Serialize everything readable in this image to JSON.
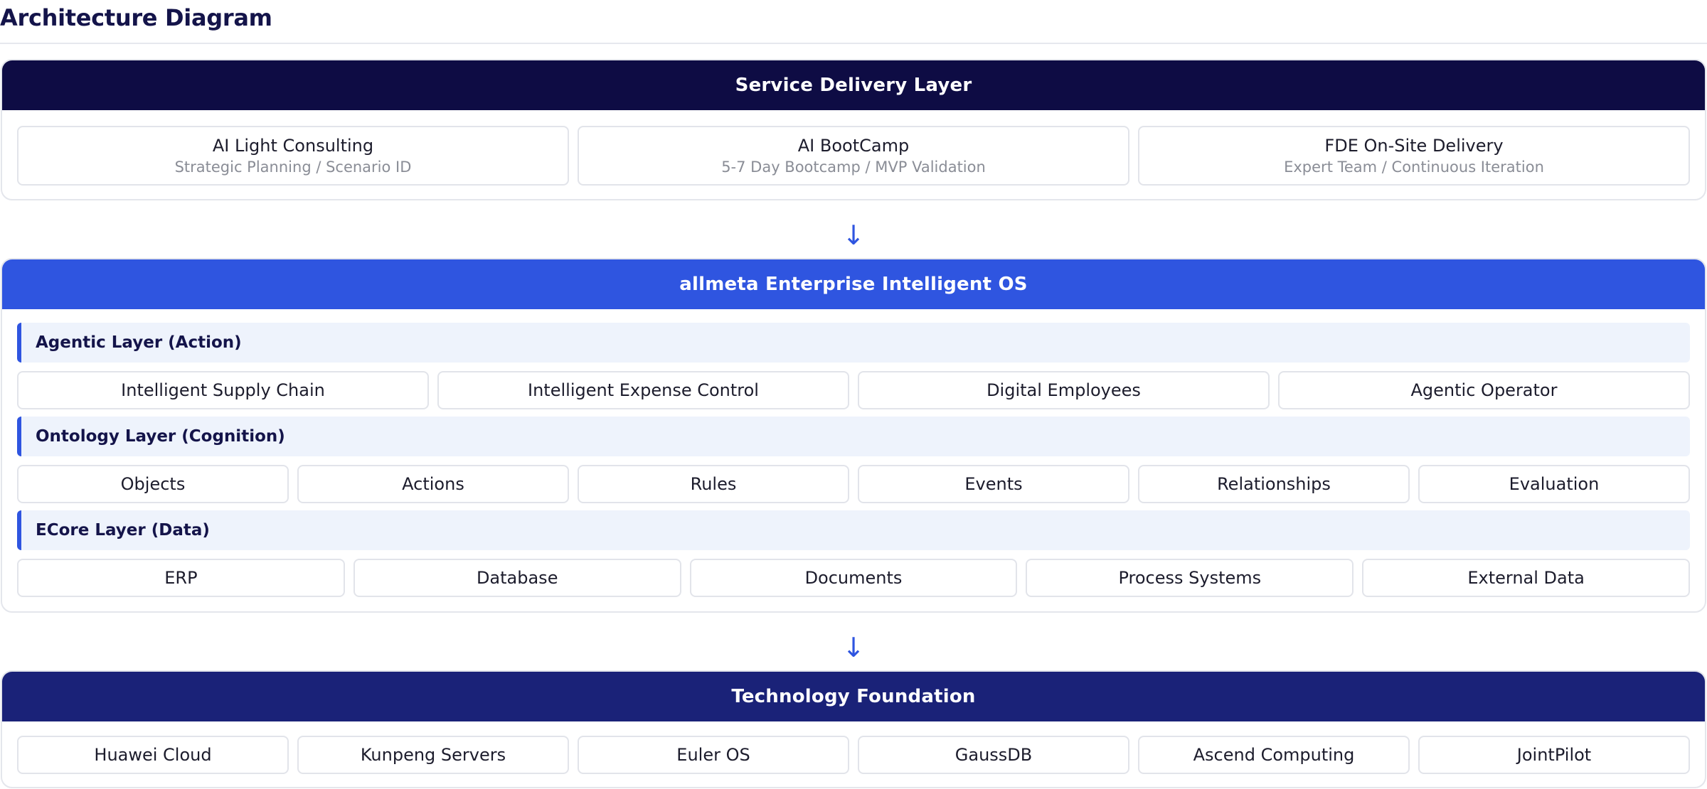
{
  "page_title": "Architecture Diagram",
  "colors": {
    "service_header": "#0e0c44",
    "os_header": "#2f55e0",
    "tech_header": "#1a2278",
    "accent": "#2f55e0",
    "sublayer_bg": "#eef3fc"
  },
  "arrow_glyph": "↓",
  "service_layer": {
    "title": "Service Delivery Layer",
    "items": [
      {
        "title": "AI Light Consulting",
        "subtitle": "Strategic Planning / Scenario ID"
      },
      {
        "title": "AI BootCamp",
        "subtitle": "5-7 Day Bootcamp / MVP Validation"
      },
      {
        "title": "FDE On-Site Delivery",
        "subtitle": "Expert Team / Continuous Iteration"
      }
    ]
  },
  "os_layer": {
    "title": "allmeta Enterprise Intelligent OS",
    "agentic": {
      "title": "Agentic Layer (Action)",
      "items": [
        "Intelligent Supply Chain",
        "Intelligent Expense Control",
        "Digital Employees",
        "Agentic Operator"
      ]
    },
    "ontology": {
      "title": "Ontology Layer (Cognition)",
      "items": [
        "Objects",
        "Actions",
        "Rules",
        "Events",
        "Relationships",
        "Evaluation"
      ]
    },
    "ecore": {
      "title": "ECore Layer (Data)",
      "items": [
        "ERP",
        "Database",
        "Documents",
        "Process Systems",
        "External Data"
      ]
    }
  },
  "tech_layer": {
    "title": "Technology Foundation",
    "items": [
      "Huawei Cloud",
      "Kunpeng Servers",
      "Euler OS",
      "GaussDB",
      "Ascend Computing",
      "JointPilot"
    ]
  }
}
